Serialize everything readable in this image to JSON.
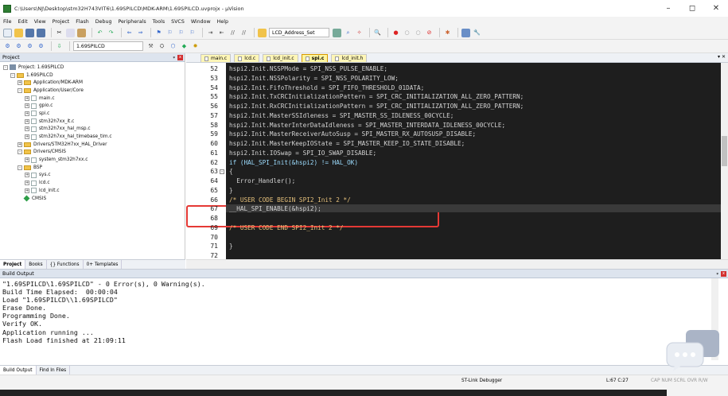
{
  "window": {
    "title": "C:\\Users\\NJ\\Desktop\\stm32H743VIT6\\1.69SPILCD\\MDK-ARM\\1.69SPILCD.uvprojx - µVision",
    "min": "–",
    "max": "◻",
    "close": "✕"
  },
  "menu": [
    "File",
    "Edit",
    "View",
    "Project",
    "Flash",
    "Debug",
    "Peripherals",
    "Tools",
    "SVCS",
    "Window",
    "Help"
  ],
  "toolbar": {
    "target": "1.69SPILCD",
    "find_combo": "LCD_Address_Set"
  },
  "project_panel": {
    "title": "Project",
    "pin": "ᵩ",
    "close": "x",
    "tree": [
      {
        "label": "Project: 1.69SPILCD",
        "indent": 0,
        "kind": "proj",
        "exp": "-"
      },
      {
        "label": "1.69SPILCD",
        "indent": 1,
        "kind": "folder",
        "exp": "-"
      },
      {
        "label": "Application/MDK-ARM",
        "indent": 2,
        "kind": "folder",
        "exp": "+"
      },
      {
        "label": "Application/User/Core",
        "indent": 2,
        "kind": "folder",
        "exp": "-"
      },
      {
        "label": "main.c",
        "indent": 3,
        "kind": "file",
        "exp": "+"
      },
      {
        "label": "gpio.c",
        "indent": 3,
        "kind": "file",
        "exp": "+"
      },
      {
        "label": "spi.c",
        "indent": 3,
        "kind": "file",
        "exp": "+"
      },
      {
        "label": "stm32h7xx_it.c",
        "indent": 3,
        "kind": "file",
        "exp": "+"
      },
      {
        "label": "stm32h7xx_hal_msp.c",
        "indent": 3,
        "kind": "file",
        "exp": "+"
      },
      {
        "label": "stm32h7xx_hal_timebase_tim.c",
        "indent": 3,
        "kind": "file",
        "exp": "+"
      },
      {
        "label": "Drivers/STM32H7xx_HAL_Driver",
        "indent": 2,
        "kind": "folder",
        "exp": "+"
      },
      {
        "label": "Drivers/CMSIS",
        "indent": 2,
        "kind": "folder",
        "exp": "-"
      },
      {
        "label": "system_stm32h7xx.c",
        "indent": 3,
        "kind": "file",
        "exp": "+"
      },
      {
        "label": "BSP",
        "indent": 2,
        "kind": "folder",
        "exp": "-"
      },
      {
        "label": "sys.c",
        "indent": 3,
        "kind": "file",
        "exp": "+"
      },
      {
        "label": "lcd.c",
        "indent": 3,
        "kind": "file",
        "exp": "+"
      },
      {
        "label": "lcd_init.c",
        "indent": 3,
        "kind": "file",
        "exp": "+"
      },
      {
        "label": "CMSIS",
        "indent": 2,
        "kind": "gem",
        "exp": ""
      }
    ],
    "footer_tabs": [
      "Project",
      "Books",
      "{} Functions",
      "0+ Templates"
    ]
  },
  "editor": {
    "tabs": [
      "main.c",
      "lcd.c",
      "lcd_init.c",
      "spi.c",
      "lcd_init.h"
    ],
    "active_tab": 3,
    "controls": "▾ ✕",
    "lines": [
      {
        "n": "52",
        "t": "hspi2.Init.NSSPMode = SPI_NSS_PULSE_ENABLE;",
        "c": "#d4d4d4"
      },
      {
        "n": "53",
        "t": "hspi2.Init.NSSPolarity = SPI_NSS_POLARITY_LOW;",
        "c": "#d4d4d4"
      },
      {
        "n": "54",
        "t": "hspi2.Init.FifoThreshold = SPI_FIFO_THRESHOLD_01DATA;",
        "c": "#d4d4d4"
      },
      {
        "n": "55",
        "t": "hspi2.Init.TxCRCInitializationPattern = SPI_CRC_INITIALIZATION_ALL_ZERO_PATTERN;",
        "c": "#d4d4d4"
      },
      {
        "n": "56",
        "t": "hspi2.Init.RxCRCInitializationPattern = SPI_CRC_INITIALIZATION_ALL_ZERO_PATTERN;",
        "c": "#d4d4d4"
      },
      {
        "n": "57",
        "t": "hspi2.Init.MasterSSIdleness = SPI_MASTER_SS_IDLENESS_00CYCLE;",
        "c": "#d4d4d4"
      },
      {
        "n": "58",
        "t": "hspi2.Init.MasterInterDataIdleness = SPI_MASTER_INTERDATA_IDLENESS_00CYCLE;",
        "c": "#d4d4d4"
      },
      {
        "n": "59",
        "t": "hspi2.Init.MasterReceiverAutoSusp = SPI_MASTER_RX_AUTOSUSP_DISABLE;",
        "c": "#d4d4d4"
      },
      {
        "n": "60",
        "t": "hspi2.Init.MasterKeepIOState = SPI_MASTER_KEEP_IO_STATE_DISABLE;",
        "c": "#d4d4d4"
      },
      {
        "n": "61",
        "t": "hspi2.Init.IOSwap = SPI_IO_SWAP_DISABLE;",
        "c": "#d4d4d4"
      },
      {
        "n": "62",
        "t": "if (HAL_SPI_Init(&hspi2) != HAL_OK)",
        "c": "#9cdcfe"
      },
      {
        "n": "63",
        "t": "{",
        "c": "#d4d4d4"
      },
      {
        "n": "64",
        "t": "  Error_Handler();",
        "c": "#d4d4d4"
      },
      {
        "n": "65",
        "t": "}",
        "c": "#d4d4d4"
      },
      {
        "n": "66",
        "t": "/* USER CODE BEGIN SPI2_Init 2 */",
        "c": "#e5c07b"
      },
      {
        "n": "67",
        "t": "__HAL_SPI_ENABLE(&hspi2);",
        "c": "#d4d4d4"
      },
      {
        "n": "68",
        "t": "",
        "c": "#d4d4d4"
      },
      {
        "n": "69",
        "t": "/* USER CODE END SPI2_Init 2 */",
        "c": "#e5c07b"
      },
      {
        "n": "70",
        "t": "",
        "c": "#d4d4d4"
      },
      {
        "n": "71",
        "t": "}",
        "c": "#d4d4d4"
      },
      {
        "n": "72",
        "t": "",
        "c": "#d4d4d4"
      }
    ],
    "highlight_color": "#e53935"
  },
  "build_output": {
    "title": "Build Output",
    "text": "\"1.69SPILCD\\1.69SPILCD\" - 0 Error(s), 0 Warning(s).\nBuild Time Elapsed:  00:00:04\nLoad \"1.69SPILCD\\\\1.69SPILCD\"\nErase Done.\nProgramming Done.\nVerify OK.\nApplication running ...\nFlash Load finished at 21:09:11"
  },
  "bottom_tabs": [
    "Build Output",
    "Find In Files"
  ],
  "status": {
    "debugger": "ST-Link Debugger",
    "position": "L:67 C:27",
    "caps": "CAP NUM SCRL OVR R/W"
  }
}
